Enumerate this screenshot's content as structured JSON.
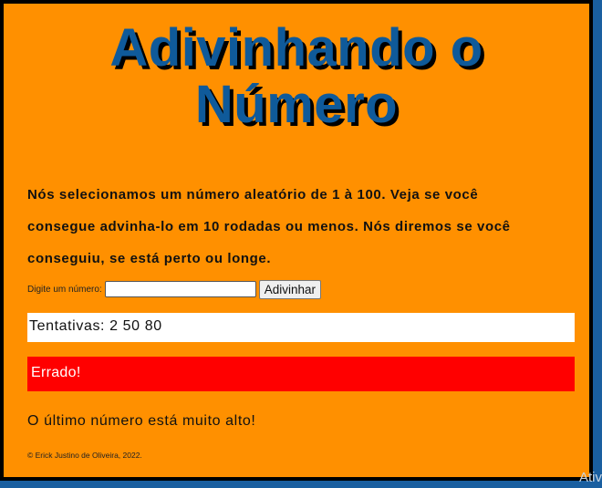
{
  "page": {
    "title_line1": "Adivinhando o",
    "title_line2": "Número",
    "intro_line1": "Nós selecionamos um número aleatório de 1 à 100. Veja se você",
    "intro_line2": "consegue advinha-lo em 10 rodadas ou menos. Nós diremos se você",
    "intro_line3": "conseguiu, se está perto ou longe.",
    "form": {
      "label": "Digite um número:",
      "input_value": "",
      "button_label": "Adivinhar"
    },
    "guesses_text": "Tentativas: 2 50 80",
    "result_text": "Errado!",
    "hint_text": "O último número está muito alto!",
    "footer_text": "© Erick Justino de Oliveira, 2022."
  },
  "overlay": {
    "watermark": "Ativ"
  },
  "colors": {
    "page_bg": "#ff9000",
    "title": "#0f5a9a",
    "result_bg": "#ff0000",
    "outer_bg": "#1a5fa0"
  }
}
